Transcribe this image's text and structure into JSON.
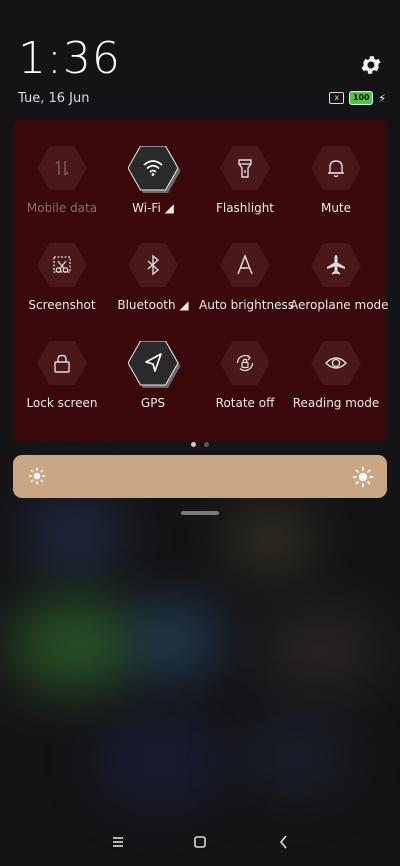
{
  "status": {
    "time": "1:36",
    "date": "Tue, 16 Jun",
    "battery": "100",
    "sim_mark": "x"
  },
  "tiles": [
    {
      "label": "Mobile data",
      "active": false,
      "disabled": true,
      "icon": "mobile-data-icon"
    },
    {
      "label": "Wi-Fi ◢",
      "active": true,
      "disabled": false,
      "icon": "wifi-icon"
    },
    {
      "label": "Flashlight",
      "active": false,
      "disabled": false,
      "icon": "flashlight-icon"
    },
    {
      "label": "Mute",
      "active": false,
      "disabled": false,
      "icon": "bell-icon"
    },
    {
      "label": "Screenshot",
      "active": false,
      "disabled": false,
      "icon": "scissors-icon"
    },
    {
      "label": "Bluetooth ◢",
      "active": false,
      "disabled": false,
      "icon": "bluetooth-icon"
    },
    {
      "label": "Auto brightness",
      "active": false,
      "disabled": false,
      "icon": "auto-brightness-icon"
    },
    {
      "label": "Aeroplane mode",
      "active": false,
      "disabled": false,
      "icon": "airplane-icon"
    },
    {
      "label": "Lock screen",
      "active": false,
      "disabled": false,
      "icon": "lock-icon"
    },
    {
      "label": "GPS",
      "active": true,
      "disabled": false,
      "icon": "location-arrow-icon"
    },
    {
      "label": "Rotate off",
      "active": false,
      "disabled": false,
      "icon": "rotate-lock-icon"
    },
    {
      "label": "Reading mode",
      "active": false,
      "disabled": false,
      "icon": "eye-icon"
    }
  ],
  "pager": {
    "pages": 2,
    "current": 1
  },
  "brightness": {
    "level": 1.0
  },
  "colors": {
    "panel": "#3a0808",
    "tile_hex": "#4a1818",
    "tile_active": "#2a2a2a",
    "brightness_bar": "#c9a785",
    "battery": "#53c241"
  },
  "nav": [
    "menu-icon",
    "home-icon",
    "back-icon"
  ]
}
